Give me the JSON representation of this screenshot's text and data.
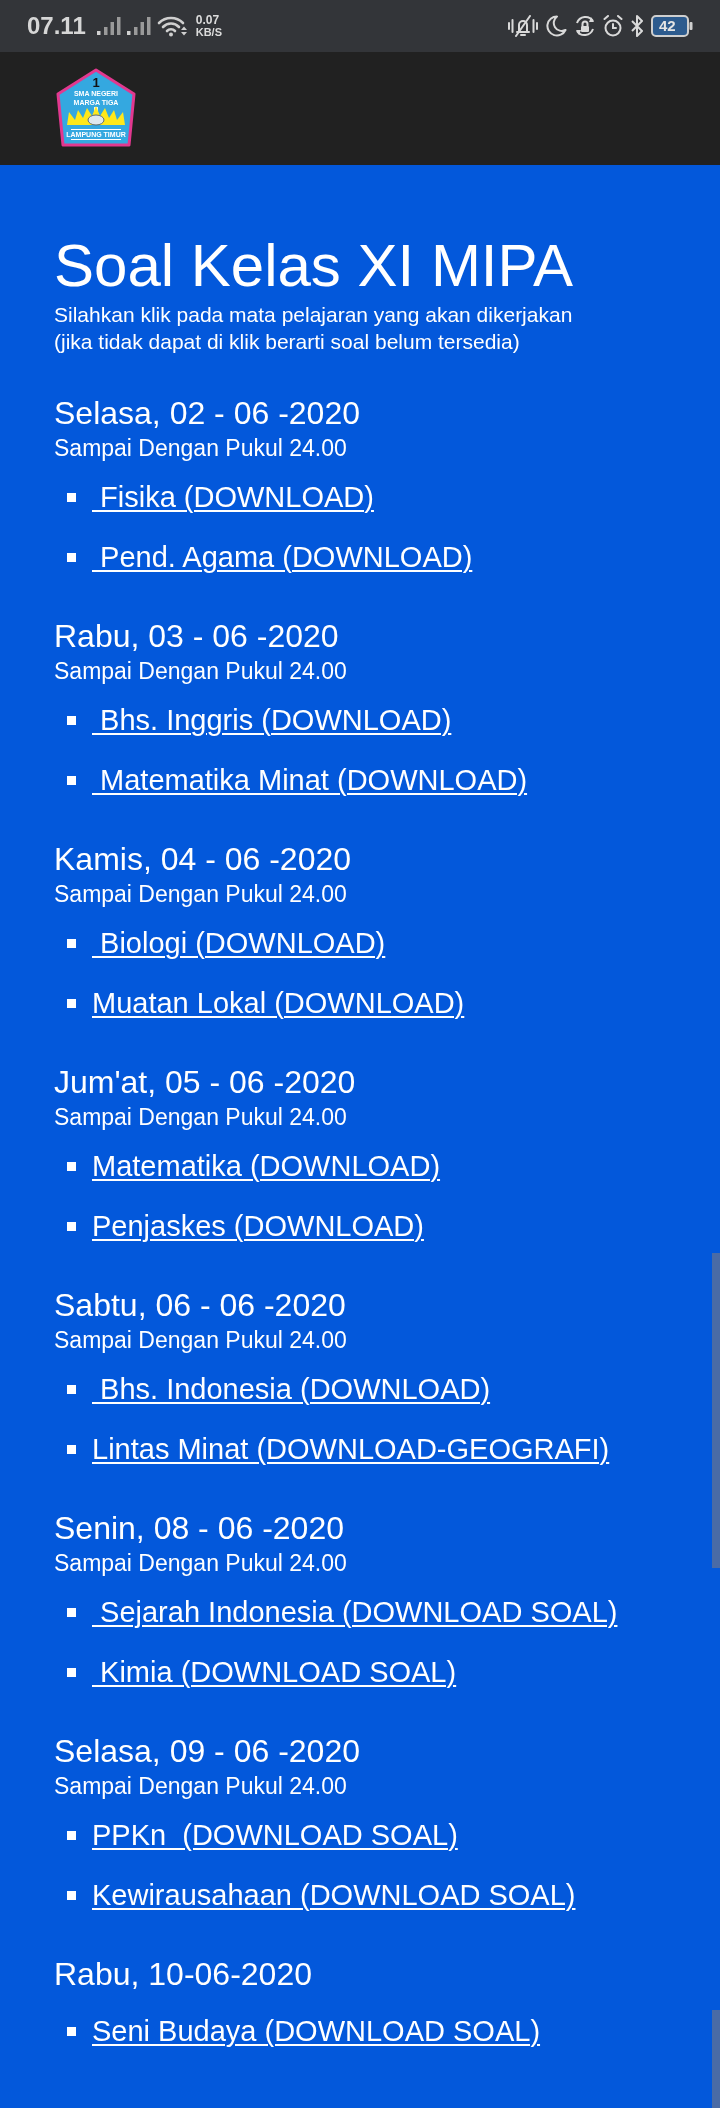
{
  "status_bar": {
    "time": "07.11",
    "net_speed": "0.07",
    "net_unit": "KB/S",
    "battery": "42"
  },
  "header": {
    "logo": {
      "left_text": "SMA NEGERI",
      "number": "1",
      "right_text": "MARGA TIGA",
      "bottom_text": "LAMPUNG TIMUR"
    }
  },
  "page": {
    "title": "Soal Kelas XI MIPA",
    "intro": "Silahkan klik pada mata pelajaran yang akan dikerjakan\n(jika tidak dapat di klik berarti soal belum tersedia)",
    "days": [
      {
        "date": "Selasa, 02 - 06 -2020",
        "deadline": "Sampai Dengan Pukul 24.00",
        "subjects": [
          " Fisika (DOWNLOAD)",
          " Pend. Agama (DOWNLOAD)"
        ]
      },
      {
        "date": "Rabu, 03 - 06 -2020",
        "deadline": "Sampai Dengan Pukul 24.00",
        "subjects": [
          " Bhs. Inggris (DOWNLOAD)",
          " Matematika Minat (DOWNLOAD)"
        ]
      },
      {
        "date": "Kamis, 04 - 06 -2020",
        "deadline": "Sampai Dengan Pukul 24.00",
        "subjects": [
          " Biologi (DOWNLOAD)",
          "Muatan Lokal (DOWNLOAD)"
        ]
      },
      {
        "date": "Jum'at, 05 - 06 -2020",
        "deadline": "Sampai Dengan Pukul 24.00",
        "subjects": [
          "Matematika (DOWNLOAD)",
          "Penjaskes (DOWNLOAD)"
        ]
      },
      {
        "date": "Sabtu, 06 - 06 -2020",
        "deadline": "Sampai Dengan Pukul 24.00",
        "subjects": [
          " Bhs. Indonesia (DOWNLOAD)",
          "Lintas Minat (DOWNLOAD-GEOGRAFI)"
        ]
      },
      {
        "date": "Senin, 08 - 06 -2020",
        "deadline": "Sampai Dengan Pukul 24.00",
        "subjects": [
          " Sejarah Indonesia (DOWNLOAD SOAL)",
          " Kimia (DOWNLOAD SOAL)"
        ]
      },
      {
        "date": "Selasa, 09 - 06 -2020",
        "deadline": "Sampai Dengan Pukul 24.00",
        "subjects": [
          "PPKn  (DOWNLOAD SOAL)",
          "Kewirausahaan (DOWNLOAD SOAL)"
        ]
      },
      {
        "date": "Rabu, 10-06-2020",
        "subjects": [
          "Seni Budaya (DOWNLOAD SOAL)"
        ]
      }
    ]
  }
}
